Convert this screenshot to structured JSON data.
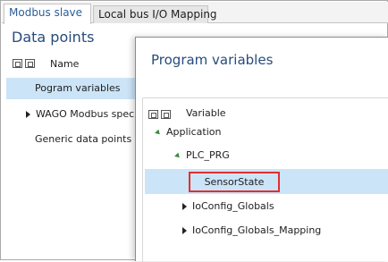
{
  "tabs": [
    {
      "label": "Modbus slave",
      "active": true
    },
    {
      "label": "Local bus I/O Mapping",
      "active": false
    }
  ],
  "left_pane": {
    "title": "Data points",
    "column_header": "Name",
    "items": [
      {
        "label": "Pogram variables",
        "selected": true
      },
      {
        "label": "WAGO  Modbus  speci",
        "expandable": true
      },
      {
        "label": "Generic data points"
      }
    ]
  },
  "dialog": {
    "title": "Program variables",
    "column_header": "Variable",
    "tree": {
      "application": "Application",
      "plc_prg": "PLC_PRG",
      "sensor_state": "SensorState",
      "ioconfig_globals": "IoConfig_Globals",
      "ioconfig_globals_mapping": "IoConfig_Globals_Mapping"
    }
  },
  "colors": {
    "accent_text": "#274c7a",
    "selection": "#cce4f7",
    "highlight_border": "#e03030"
  }
}
